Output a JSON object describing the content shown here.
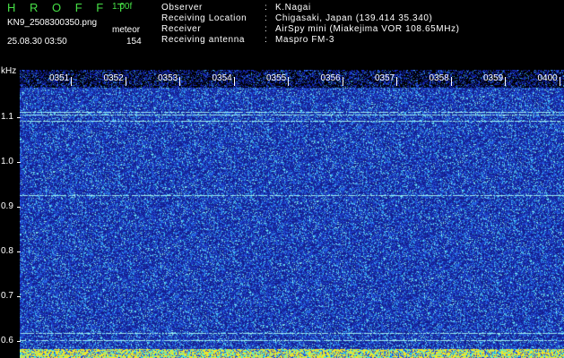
{
  "header": {
    "title": "H R O F F T",
    "version": "1.00f",
    "filename": "KN9_2508300350.png",
    "meteor_label": "meteor",
    "datetime": "25.08.30 03:50",
    "meteor_count": "154",
    "info": [
      {
        "label": "Observer",
        "value": "K.Nagai"
      },
      {
        "label": "Receiving Location",
        "value": "Chigasaki, Japan (139.414 35.340)"
      },
      {
        "label": "Receiver",
        "value": "AirSpy mini (Miakejima VOR 108.65MHz)"
      },
      {
        "label": "Receiving antenna",
        "value": "Maspro FM-3"
      }
    ]
  },
  "axes": {
    "y_unit": "kHz",
    "y_ticks": [
      "1.1",
      "1.0",
      "0.9",
      "0.8",
      "0.7",
      "0.6"
    ],
    "time_ticks": [
      "0351",
      "0352",
      "0353",
      "0354",
      "0355",
      "0356",
      "0357",
      "0358",
      "0359",
      "0400"
    ]
  },
  "colors": {
    "header_text_green": "#46e046",
    "background": "#000000",
    "spectrogram_base": "#1a2fd0"
  }
}
